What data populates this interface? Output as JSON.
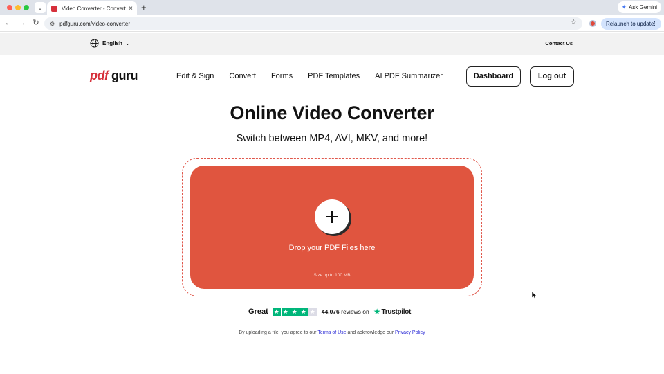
{
  "browser": {
    "tab_title": "Video Converter - Convert Vi",
    "new_tab": "+",
    "ask_gemini": "Ask Gemini",
    "url": "pdfguru.com/video-converter",
    "relaunch": "Relaunch to update"
  },
  "utility": {
    "language": "English",
    "contact": "Contact Us"
  },
  "header": {
    "logo_pdf": "pdf",
    "logo_guru": "guru",
    "nav": [
      "Edit & Sign",
      "Convert",
      "Forms",
      "PDF Templates",
      "AI PDF Summarizer"
    ],
    "dashboard": "Dashboard",
    "logout": "Log out"
  },
  "hero": {
    "title": "Online Video Converter",
    "subtitle": "Switch between MP4, AVI, MKV, and more!",
    "drop_label": "Drop your PDF Files here",
    "size_label": "Size up to 100 MB"
  },
  "trust": {
    "rating_word": "Great",
    "stars_filled": 4,
    "stars_total": 5,
    "review_count": "44,076",
    "reviews_suffix": "reviews on",
    "brand": "Trustpilot"
  },
  "legal": {
    "prefix": "By uploading a file, you agree to our ",
    "terms": "Terms of Use",
    "middle": " and acknowledge our",
    "privacy": " Privacy Policy"
  },
  "colors": {
    "brand_red": "#d6303b",
    "drop_zone": "#e0553f",
    "trustpilot_green": "#00b67a"
  }
}
